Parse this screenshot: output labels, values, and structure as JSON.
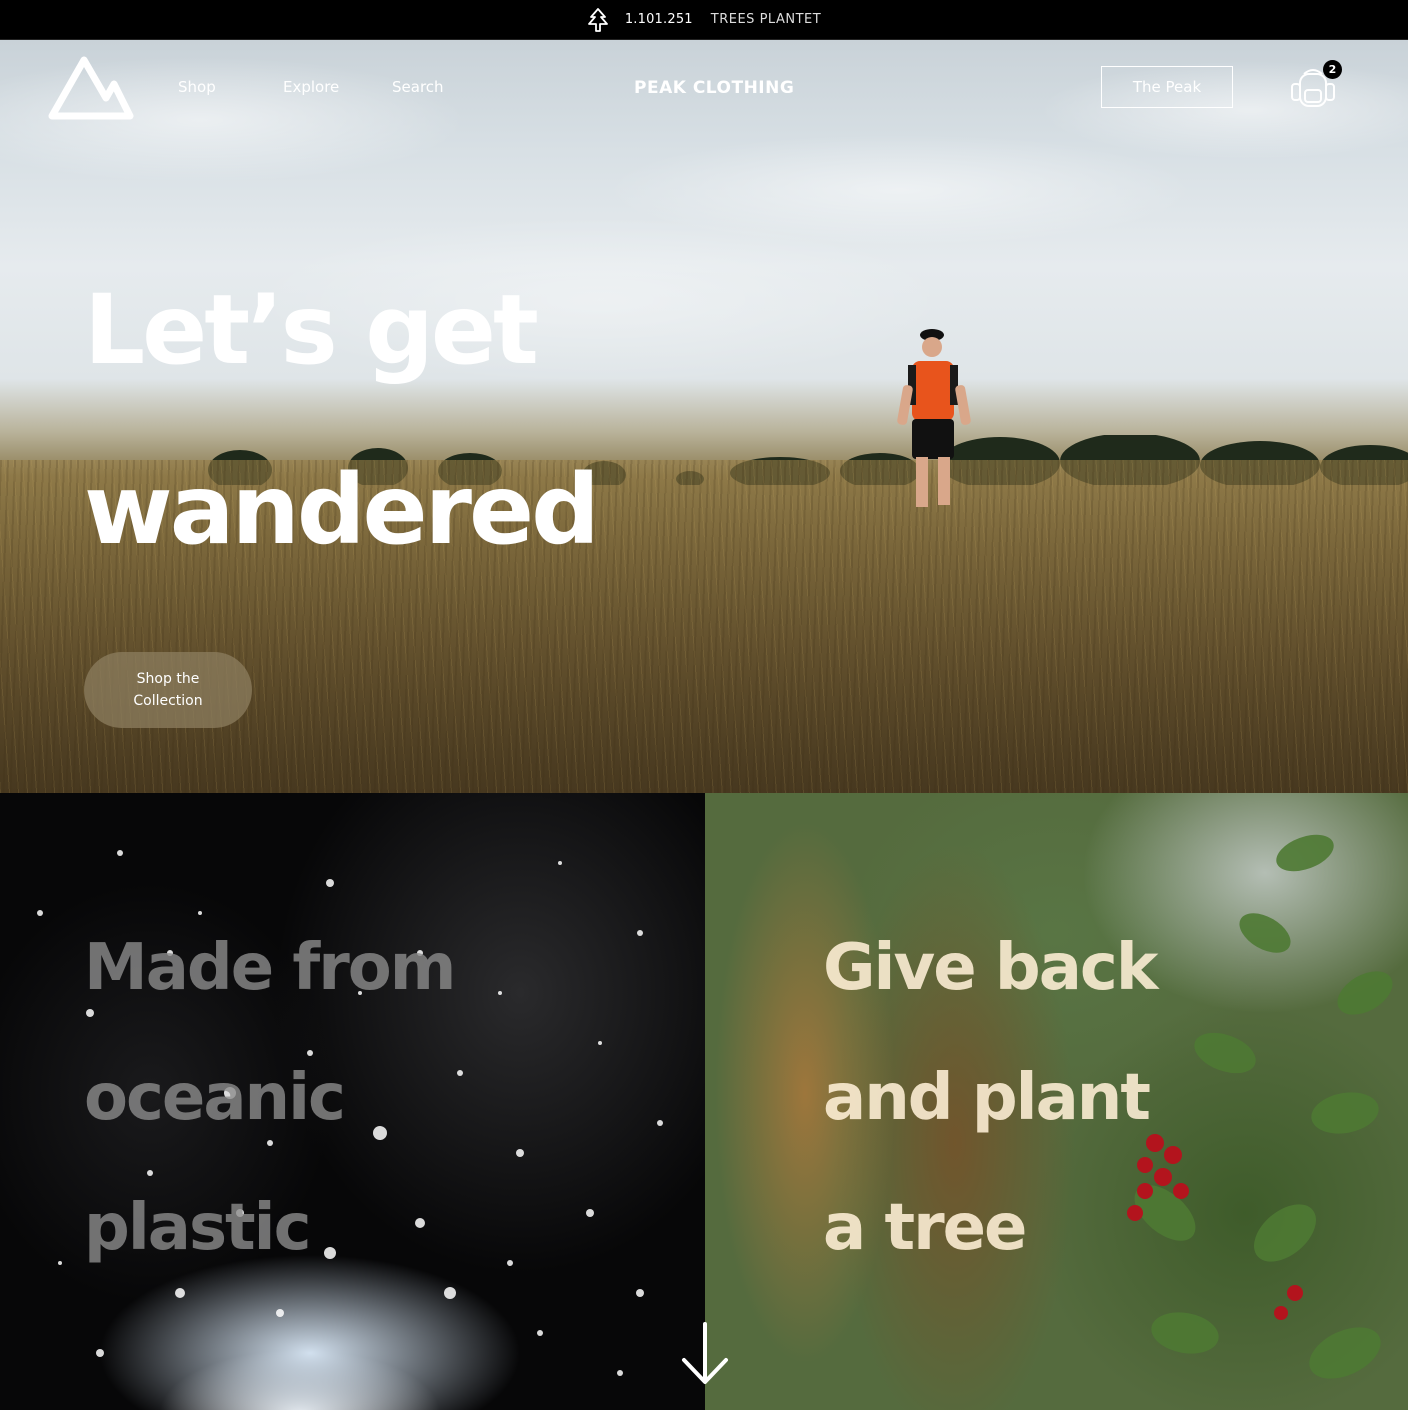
{
  "topbar": {
    "tree_icon": "tree-icon",
    "count": "1.101.251",
    "label": "TREES PLANTET"
  },
  "nav": {
    "logo_icon": "mountain-logo-icon",
    "links": [
      "Shop",
      "Explore",
      "Search"
    ],
    "brand": "PEAK CLOTHING",
    "peak_button": "The Peak",
    "cart_icon": "backpack-cart-icon",
    "cart_count": "2"
  },
  "hero": {
    "title_line1": "Let’s get",
    "title_line2": "wandered",
    "cta_line1": "Shop the",
    "cta_line2": "Collection"
  },
  "panels": {
    "left": {
      "line1": "Made from",
      "line2": "oceanic",
      "line3": "plastic"
    },
    "right": {
      "line1": "Give back",
      "line2": "and plant",
      "line3": "a tree"
    }
  },
  "scroll_icon": "arrow-down-icon"
}
